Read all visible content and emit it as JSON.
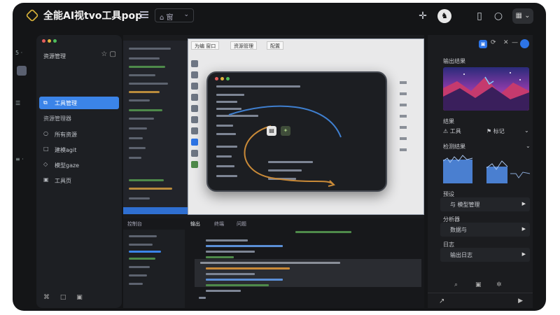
{
  "app": {
    "title": "全能AI视tvo工具pop",
    "dropdown_label": "⌂ 窗",
    "dropdown_chevron": "⌄"
  },
  "toolbar_icons": [
    "crosshair-icon",
    "badge-icon",
    "book-icon",
    "circle-icon",
    "calendar-icon"
  ],
  "toolbar": {
    "badge_glyph": "♞",
    "calendar_glyph": "▦ ⌄"
  },
  "left_strip": [
    "5 ·",
    "☰",
    "≡ ·"
  ],
  "sidebar": {
    "header": "资源管理",
    "active_item": "工具管理",
    "section": "资源管理器",
    "items": [
      {
        "label": "所有资源",
        "icon": "○"
      },
      {
        "label": "建模agit",
        "icon": "□"
      },
      {
        "label": "模型gaze",
        "icon": "◇"
      },
      {
        "label": "工具页",
        "icon": "▣"
      }
    ],
    "bottom_icons": "⌘ □ ▣"
  },
  "preview": {
    "tabs": [
      "为编 窗口",
      "资源管理",
      "配置"
    ]
  },
  "bottom_panel": {
    "tabs": [
      "控制台",
      "输出",
      "终端",
      "问题"
    ]
  },
  "right_panel": {
    "section_top": "输出结果",
    "tools_label": "结果",
    "tool_a": "工具",
    "tool_b": "标记",
    "chart_title": "检测结果",
    "cards": [
      {
        "title": "预设",
        "text": "与 模型管理",
        "arrow": "▶"
      },
      {
        "title": "分析器",
        "text": "数据与",
        "arrow": "▶"
      },
      {
        "title": "日志",
        "text": "输出日志",
        "arrow": "▶"
      }
    ],
    "bottom_left": "↗",
    "bottom_right": "▶"
  },
  "colors": {
    "accent_blue": "#3b84e8",
    "code_green": "#4e8a4a",
    "code_orange": "#c98a38",
    "frame_bg": "#141517"
  }
}
